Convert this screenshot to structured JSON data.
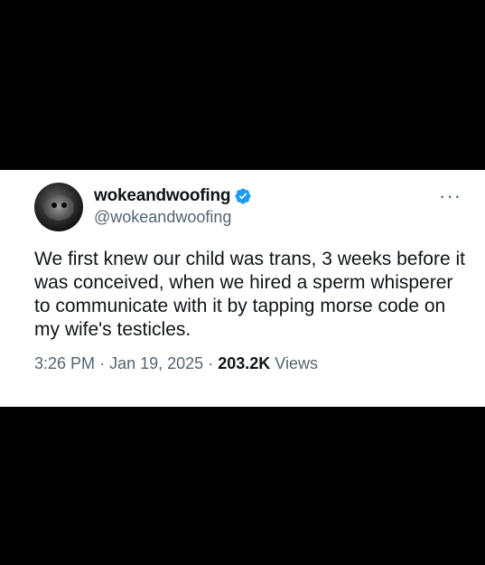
{
  "tweet": {
    "display_name": "wokeandwoofing",
    "handle": "@wokeandwoofing",
    "text": "We first knew our child was trans, 3 weeks before it was conceived, when we hired a sperm whisperer to communicate with it by tapping morse code on my wife's testicles.",
    "time": "3:26 PM",
    "date": "Jan 19, 2025",
    "separator": "·",
    "views_count": "203.2K",
    "views_label": "Views",
    "more_glyph": "···"
  },
  "icons": {
    "verified": "verified-badge-icon",
    "more": "more-options-icon",
    "avatar": "avatar"
  },
  "colors": {
    "background": "#000000",
    "card": "#ffffff",
    "text": "#0f1419",
    "muted": "#536471",
    "verified": "#1d9bf0"
  }
}
